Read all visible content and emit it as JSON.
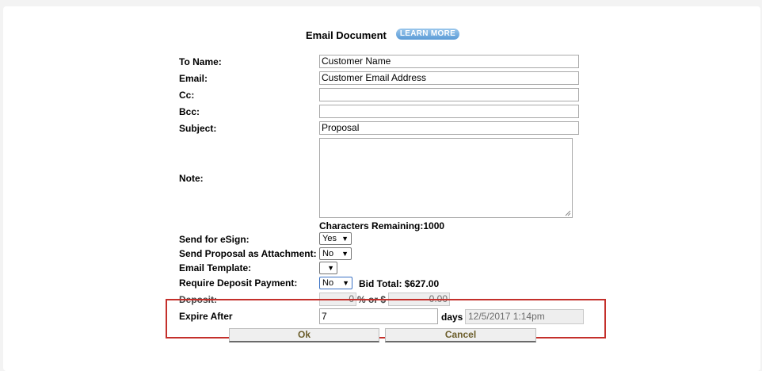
{
  "header": {
    "title": "Email Document",
    "learn_more": "LEARN MORE"
  },
  "fields": {
    "to_name": {
      "label": "To Name:",
      "value": "Customer Name"
    },
    "email": {
      "label": "Email:",
      "value": "Customer Email Address"
    },
    "cc": {
      "label": "Cc:",
      "value": ""
    },
    "bcc": {
      "label": "Bcc:",
      "value": ""
    },
    "subject": {
      "label": "Subject:",
      "value": "Proposal"
    },
    "note": {
      "label": "Note:",
      "value": ""
    },
    "chars_remaining": "Characters Remaining:1000",
    "send_esign": {
      "label": "Send for eSign:",
      "value": "Yes"
    },
    "send_attachment": {
      "label": "Send Proposal as Attachment:",
      "value": "No"
    },
    "email_template": {
      "label": "Email Template:",
      "value": ""
    },
    "require_deposit": {
      "label": "Require Deposit Payment:",
      "value": "No"
    },
    "bid_total": "Bid Total: $627.00",
    "deposit": {
      "label": "Deposit:",
      "percent_value": "0",
      "percent_or": "% or $",
      "amount_value": "0.00"
    },
    "expire_after": {
      "label": "Expire After",
      "value": "7",
      "days": "days",
      "expire_date": "12/5/2017 1:14pm"
    }
  },
  "buttons": {
    "ok": "Ok",
    "cancel": "Cancel"
  },
  "colors": {
    "highlight_border": "#c4302b",
    "learn_more_bg": "#5a9ad6",
    "button_text": "#6b5d2a"
  }
}
